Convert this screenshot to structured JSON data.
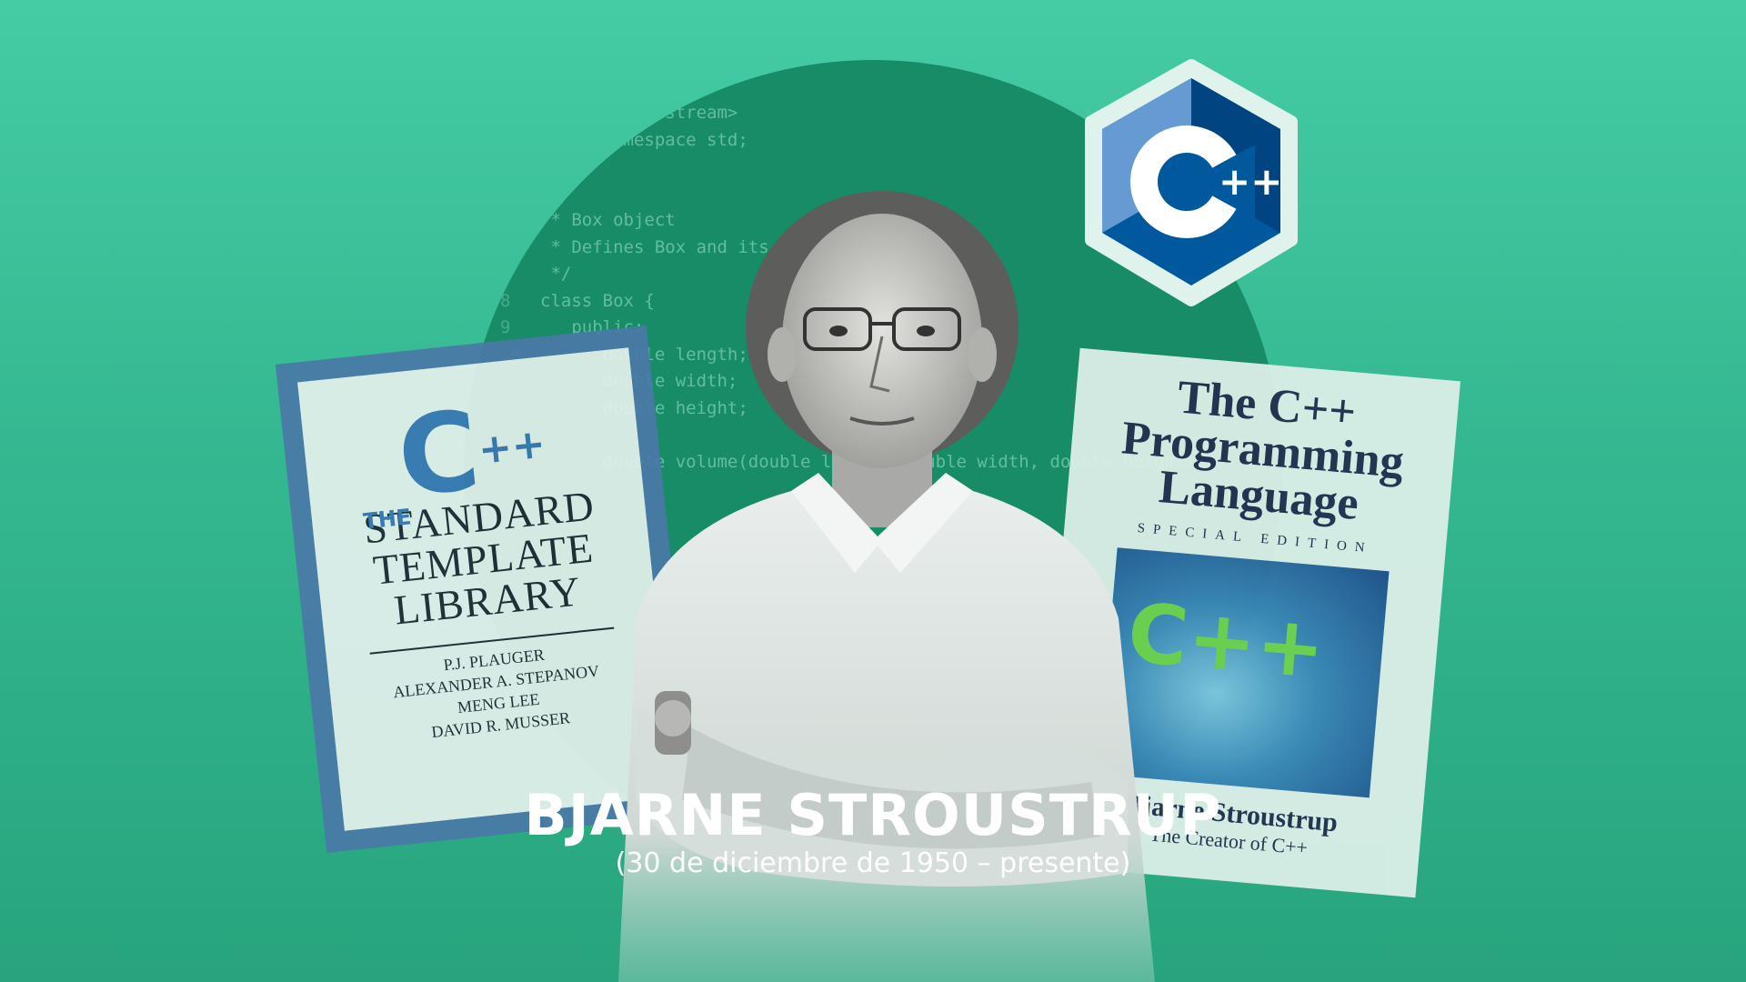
{
  "code_lines": [
    {
      "n": "",
      "t": "#include <iostream>"
    },
    {
      "n": "",
      "t": "using namespace std;"
    },
    {
      "n": "",
      "t": ""
    },
    {
      "n": "",
      "t": "/*"
    },
    {
      "n": "",
      "t": " * Box object"
    },
    {
      "n": "",
      "t": " * Defines Box and its"
    },
    {
      "n": "",
      "t": " */"
    },
    {
      "n": "8",
      "t": "class Box {"
    },
    {
      "n": "9",
      "t": "   public:"
    },
    {
      "n": "10",
      "t": "      double length;"
    },
    {
      "n": "",
      "t": "      double width;"
    },
    {
      "n": "",
      "t": "      double height;"
    },
    {
      "n": "",
      "t": ""
    },
    {
      "n": "",
      "t": "      double volume(double length, double width, double height);"
    }
  ],
  "book_left": {
    "the": "THE",
    "c": "C",
    "plus": "++",
    "title_lines": [
      "STANDARD",
      "TEMPLATE",
      "LIBRARY"
    ],
    "authors": [
      "P.J. PLAUGER",
      "ALEXANDER A. STEPANOV",
      "MENG LEE",
      "DAVID R. MUSSER"
    ]
  },
  "book_right": {
    "title_lines": [
      "The C++",
      "Programming",
      "Language"
    ],
    "edition": "SPECIAL EDITION",
    "art_text": "C++",
    "author": "Bjarne Stroustrup",
    "subtitle": "The Creator of C++"
  },
  "logo": {
    "c": "C",
    "plus": "++"
  },
  "caption": {
    "name": "BJARNE STROUSTRUP",
    "dates": "(30 de diciembre de 1950 – presente)"
  },
  "colors": {
    "background": "#3cbf98",
    "circle": "#178c66",
    "logo_blue": "#3f7cc0"
  }
}
